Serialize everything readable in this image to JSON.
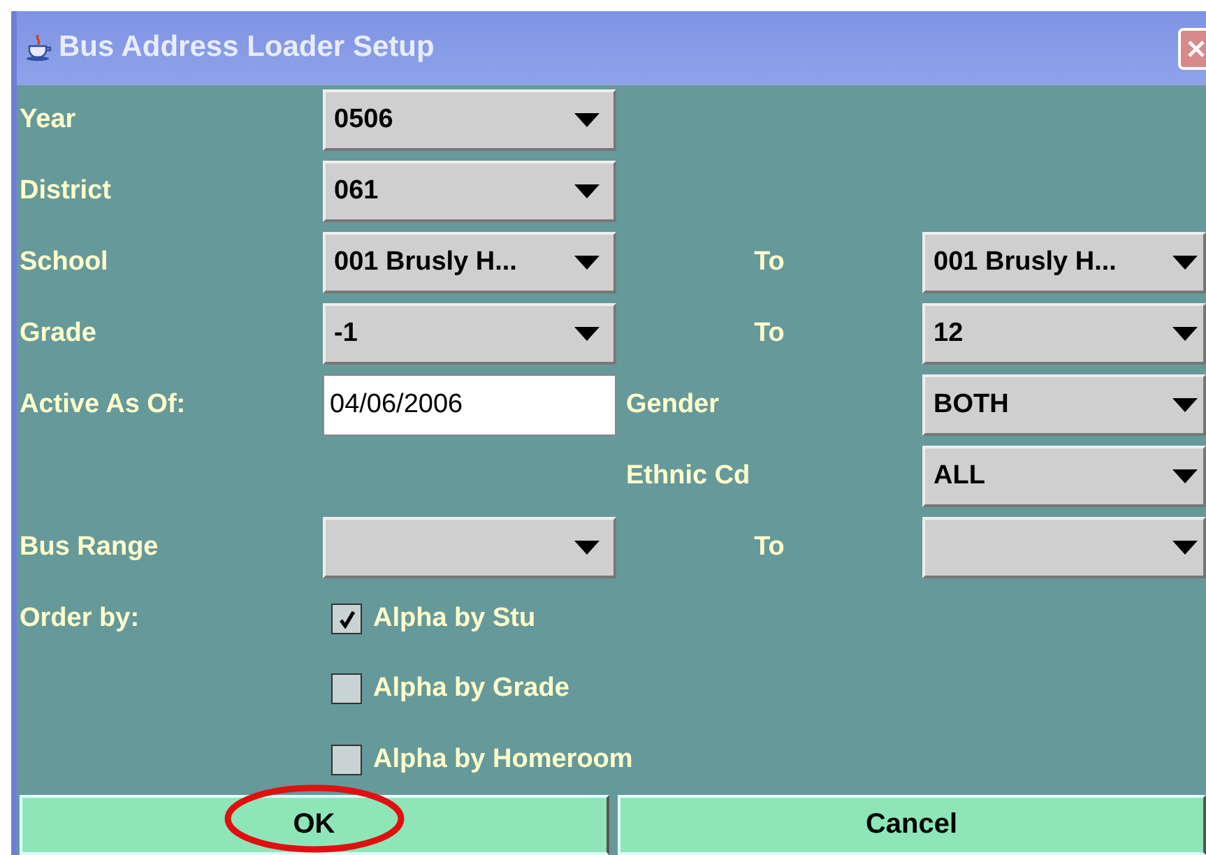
{
  "window": {
    "title": "Bus Address Loader Setup"
  },
  "rows": [
    {
      "label": "Year",
      "field": {
        "kind": "combo",
        "value": "0506"
      }
    },
    {
      "label": "District",
      "field": {
        "kind": "combo",
        "value": "061"
      }
    },
    {
      "label": "School",
      "field": {
        "kind": "combo",
        "value": "001 Brusly H..."
      },
      "side_label": "To",
      "side_field": {
        "kind": "combo",
        "value": "001 Brusly H..."
      }
    },
    {
      "label": "Grade",
      "field": {
        "kind": "combo",
        "value": "-1"
      },
      "side_label": "To",
      "side_field": {
        "kind": "combo",
        "value": "12"
      }
    },
    {
      "label": "Active As Of:",
      "field": {
        "kind": "text",
        "value": "04/06/2006"
      },
      "side_label": "Gender",
      "side_field": {
        "kind": "combo",
        "value": "BOTH"
      }
    },
    {
      "side_label": "Ethnic Cd",
      "side_field": {
        "kind": "combo",
        "value": "ALL"
      }
    },
    {
      "label": "Bus Range",
      "field": {
        "kind": "combo"
      },
      "side_label": "To",
      "side_field": {
        "kind": "combo"
      }
    }
  ],
  "order_by": {
    "label": "Order by:",
    "options": [
      {
        "label": "Alpha by Stu",
        "checked": true
      },
      {
        "label": "Alpha by Grade",
        "checked": false
      },
      {
        "label": "Alpha by Homeroom",
        "checked": false
      }
    ]
  },
  "buttons": [
    {
      "label": "OK",
      "highlighted": true
    },
    {
      "label": "Cancel",
      "highlighted": false
    }
  ]
}
